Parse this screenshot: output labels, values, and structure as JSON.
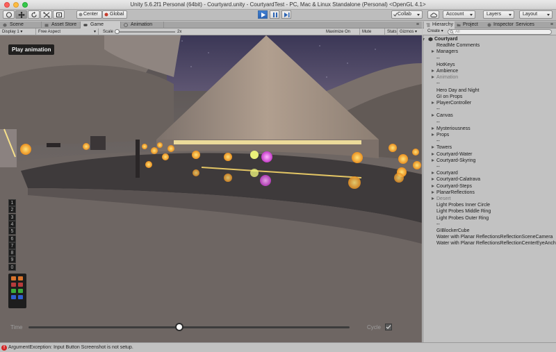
{
  "window": {
    "title": "Unity 5.6.2f1 Personal (64bit) - Courtyard.unity - CourtyardTest - PC, Mac & Linux Standalone (Personal) <OpenGL 4.1>"
  },
  "toolbar": {
    "pivot_label": "Center",
    "space_label": "Global",
    "collab_label": "Collab",
    "account_label": "Account",
    "layers_label": "Layers",
    "layout_label": "Layout",
    "play_color": "#2f6fc8"
  },
  "tabs": {
    "scene": "Scene",
    "asset_store": "Asset Store",
    "game": "Game",
    "animation": "Animation"
  },
  "game_toolbar": {
    "display": "Display 1",
    "aspect": "Free Aspect",
    "scale_label": "Scale",
    "scale_value": "2x",
    "maximize": "Maximize On Play",
    "mute": "Mute Audio",
    "stats": "Stats",
    "gizmos": "Gizmos"
  },
  "game_view": {
    "play_animation": "Play animation",
    "camera_buttons": [
      "1",
      "2",
      "3",
      "4",
      "5",
      "6",
      "7",
      "8",
      "9",
      "0"
    ],
    "swatches": [
      "#d8732c",
      "#d8732c",
      "#b63b3b",
      "#b63b3b",
      "#3bab3b",
      "#3bab3b",
      "#2f5fd0",
      "#2f5fd0"
    ],
    "time_label": "Time",
    "time_value": 0.47,
    "cycle_label": "Cycle"
  },
  "hierarchy": {
    "tabs": {
      "hierarchy": "Hierarchy",
      "project": "Project",
      "inspector": "Inspector",
      "services": "Services"
    },
    "create_label": "Create",
    "search_placeholder": "All",
    "rows": [
      {
        "label": "Courtyard",
        "indent": 0,
        "arrow": "down",
        "root": true
      },
      {
        "label": "ReadMe Comments",
        "indent": 1,
        "arrow": ""
      },
      {
        "label": "Managers",
        "indent": 1,
        "arrow": "right"
      },
      {
        "label": "--",
        "indent": 1,
        "arrow": ""
      },
      {
        "label": "HotKeys",
        "indent": 1,
        "arrow": ""
      },
      {
        "label": "Ambience",
        "indent": 1,
        "arrow": "right"
      },
      {
        "label": "Animation",
        "indent": 1,
        "arrow": "right",
        "disabled": true
      },
      {
        "label": "--",
        "indent": 1,
        "arrow": ""
      },
      {
        "label": "Hero Day and Night",
        "indent": 1,
        "arrow": ""
      },
      {
        "label": "GI on Props",
        "indent": 1,
        "arrow": ""
      },
      {
        "label": "PlayerController",
        "indent": 1,
        "arrow": "right"
      },
      {
        "label": "--",
        "indent": 1,
        "arrow": ""
      },
      {
        "label": "Canvas",
        "indent": 1,
        "arrow": "right"
      },
      {
        "label": "--",
        "indent": 1,
        "arrow": ""
      },
      {
        "label": "Mysteriousness",
        "indent": 1,
        "arrow": "right"
      },
      {
        "label": "Props",
        "indent": 1,
        "arrow": "right"
      },
      {
        "label": "--",
        "indent": 1,
        "arrow": ""
      },
      {
        "label": "Towers",
        "indent": 1,
        "arrow": "right"
      },
      {
        "label": "Courtyard-Water",
        "indent": 1,
        "arrow": "right"
      },
      {
        "label": "Courtyard-Skyring",
        "indent": 1,
        "arrow": "right"
      },
      {
        "label": "--",
        "indent": 1,
        "arrow": ""
      },
      {
        "label": "Courtyard",
        "indent": 1,
        "arrow": "right"
      },
      {
        "label": "Courtyard-Calatrava",
        "indent": 1,
        "arrow": "right"
      },
      {
        "label": "Courtyard-Steps",
        "indent": 1,
        "arrow": "right"
      },
      {
        "label": "PlanarReflections",
        "indent": 1,
        "arrow": "right"
      },
      {
        "label": "Desert",
        "indent": 1,
        "arrow": "right",
        "disabled": true
      },
      {
        "label": "Light Probes Inner Circle",
        "indent": 1,
        "arrow": ""
      },
      {
        "label": "Light Probes Middle Ring",
        "indent": 1,
        "arrow": ""
      },
      {
        "label": "Light Probes Outer Ring",
        "indent": 1,
        "arrow": ""
      },
      {
        "label": "--",
        "indent": 1,
        "arrow": ""
      },
      {
        "label": "GIBlockerCube",
        "indent": 1,
        "arrow": ""
      },
      {
        "label": "Water with Planar ReflectionsReflectionSceneCamera",
        "indent": 1,
        "arrow": ""
      },
      {
        "label": "Water with Planar ReflectionsReflectionCenterEyeAnchor",
        "indent": 1,
        "arrow": ""
      }
    ]
  },
  "status": {
    "message": "ArgumentException: Input Button Screenshot is not setup."
  }
}
